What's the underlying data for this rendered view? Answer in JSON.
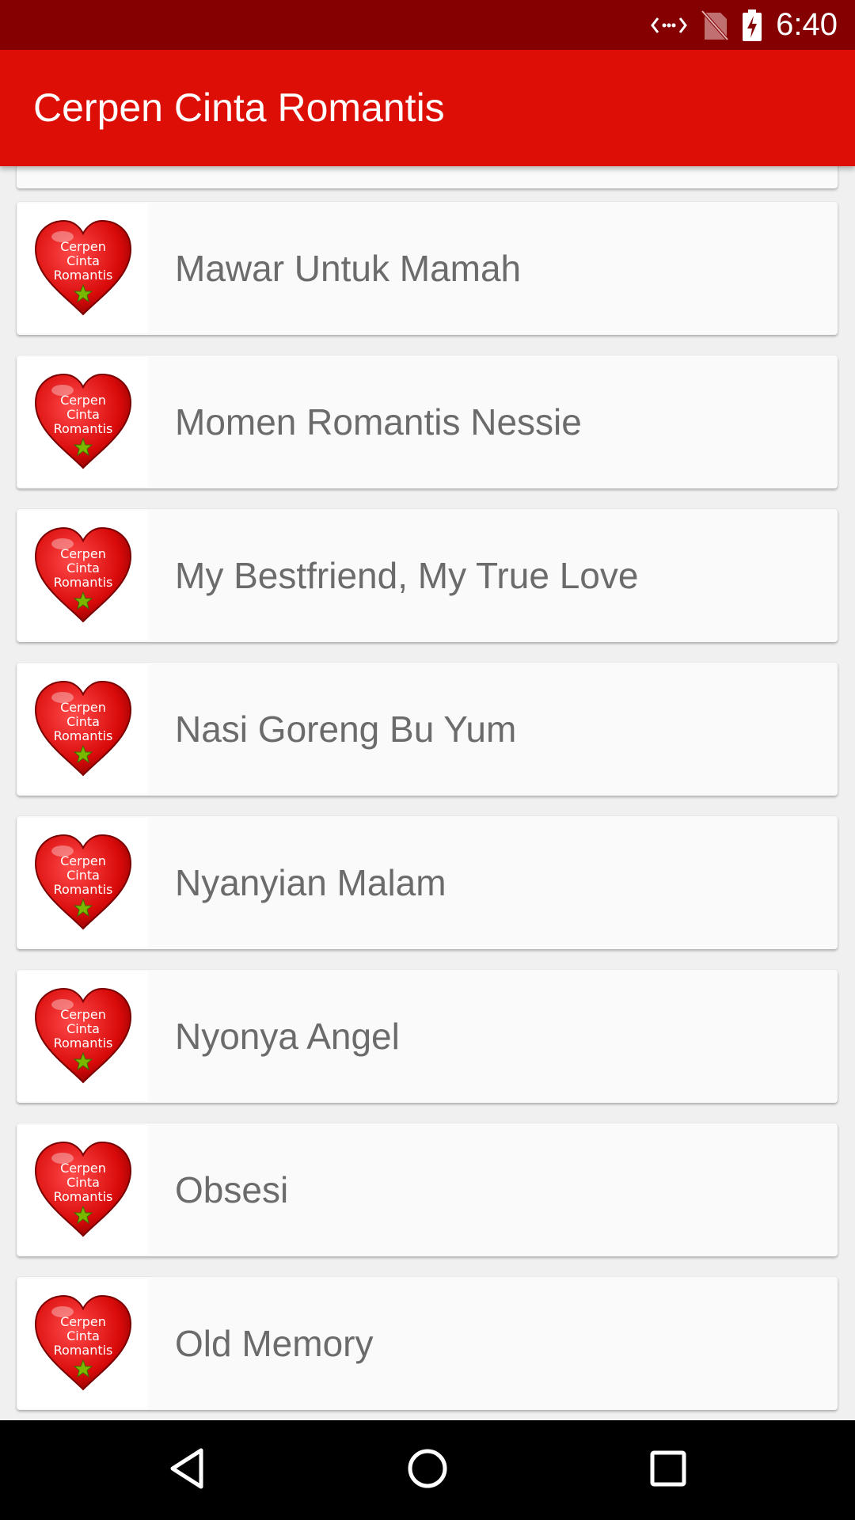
{
  "status_bar": {
    "time": "6:40",
    "icons": [
      "data-transfer-icon",
      "no-sim-icon",
      "battery-charging-icon"
    ]
  },
  "app_bar": {
    "title": "Cerpen Cinta Romantis"
  },
  "thumbnail": {
    "icon": "heart-logo-icon",
    "lines": [
      "Cerpen",
      "Cinta",
      "Romantis"
    ],
    "heart_color": "#d90a0a",
    "star_color": "#7ab800"
  },
  "stories": [
    {
      "title": "Mawar Untuk Mamah"
    },
    {
      "title": "Momen Romantis Nessie"
    },
    {
      "title": "My Bestfriend, My True Love"
    },
    {
      "title": "Nasi Goreng Bu Yum"
    },
    {
      "title": "Nyanyian Malam"
    },
    {
      "title": "Nyonya Angel"
    },
    {
      "title": "Obsesi"
    },
    {
      "title": "Old Memory"
    }
  ],
  "nav_bar": {
    "buttons": [
      "back-icon",
      "home-icon",
      "recents-icon"
    ]
  },
  "colors": {
    "status_bar": "#850000",
    "app_bar": "#dd0e05",
    "card_bg": "#fafafa",
    "list_bg": "#f0f0f0"
  }
}
